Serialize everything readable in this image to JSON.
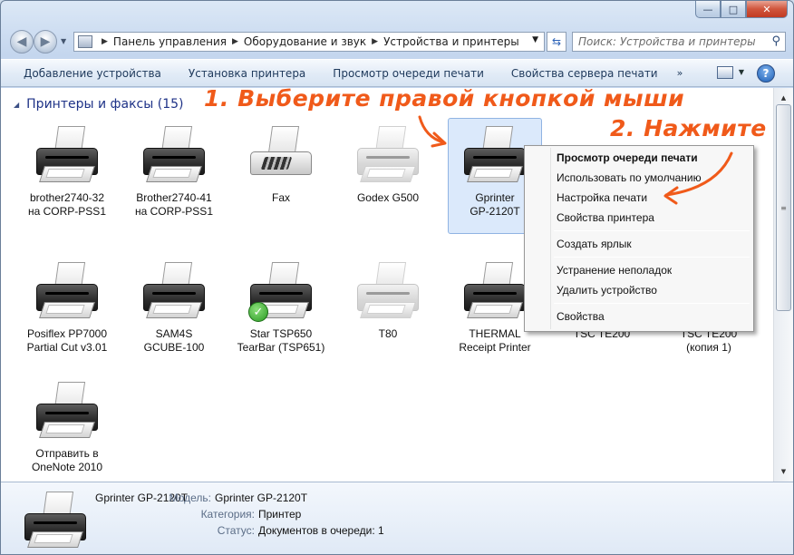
{
  "window": {
    "caption": {
      "minimize": "—",
      "maximize": "□",
      "close": "✕"
    }
  },
  "address": {
    "crumbs": [
      "Панель управления",
      "Оборудование и звук",
      "Устройства и принтеры"
    ],
    "search_placeholder": "Поиск: Устройства и принтеры"
  },
  "toolbar": {
    "commands": [
      "Добавление устройства",
      "Установка принтера",
      "Просмотр очереди печати",
      "Свойства сервера печати"
    ],
    "more": "»",
    "help": "?"
  },
  "group": {
    "title": "Принтеры и факсы (15)"
  },
  "devices": [
    {
      "line1": "brother2740-32",
      "line2": "на CORP-PSS1"
    },
    {
      "line1": "Brother2740-41",
      "line2": "на CORP-PSS1"
    },
    {
      "line1": "Fax",
      "line2": ""
    },
    {
      "line1": "Godex G500",
      "line2": ""
    },
    {
      "line1": "Gprinter",
      "line2": "GP-2120T"
    },
    {
      "line1": "Posiflex PP7000",
      "line2": "Partial Cut v3.01"
    },
    {
      "line1": "SAM4S",
      "line2": "GCUBE-100"
    },
    {
      "line1": "Star TSP650",
      "line2": "TearBar (TSP651)"
    },
    {
      "line1": "T80",
      "line2": ""
    },
    {
      "line1": "THERMAL",
      "line2": "Receipt Printer"
    },
    {
      "line1": "TSC TE200",
      "line2": ""
    },
    {
      "line1": "TSC TE200",
      "line2": "(копия 1)"
    },
    {
      "line1": "Отправить в",
      "line2": "OneNote 2010"
    }
  ],
  "context_menu": {
    "items": [
      "Просмотр очереди печати",
      "Использовать по умолчанию",
      "Настройка печати",
      "Свойства принтера",
      "Создать ярлык",
      "Устранение неполадок",
      "Удалить устройство",
      "Свойства"
    ]
  },
  "annotations": {
    "step1": "1. Выберите правой кнопкой мыши",
    "step2": "2. Нажмите",
    "color": "#f05a1a"
  },
  "details": {
    "name": "Gprinter  GP-2120T",
    "model_key": "Модель:",
    "model_val": "Gprinter  GP-2120T",
    "category_key": "Категория:",
    "category_val": "Принтер",
    "status_key": "Статус:",
    "status_val": "Документов в очереди: 1"
  }
}
